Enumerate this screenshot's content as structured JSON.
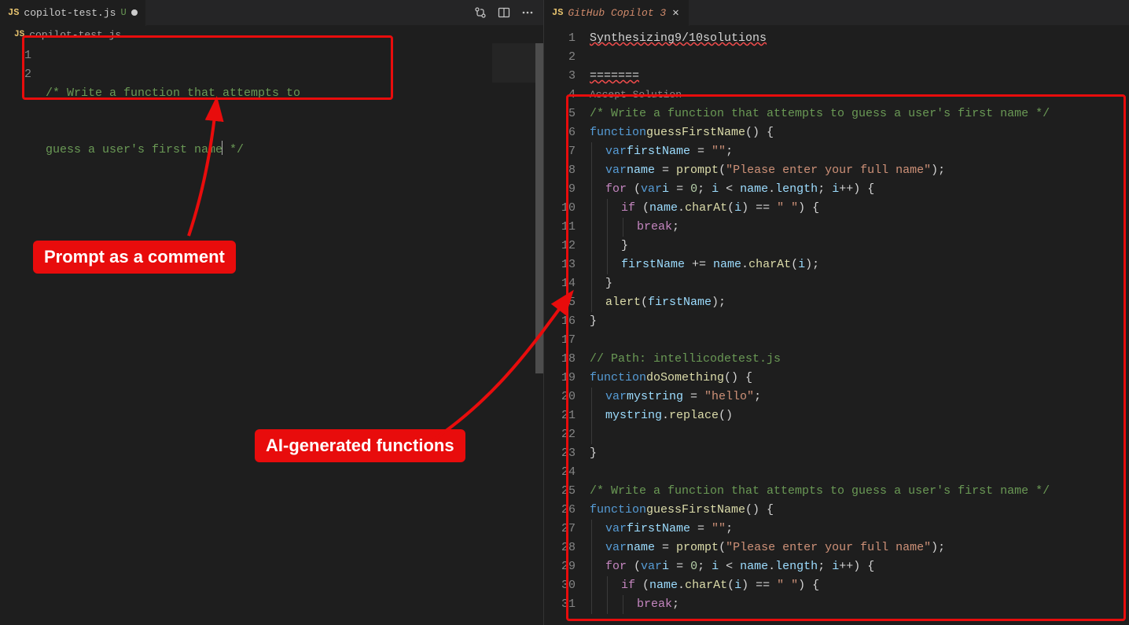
{
  "left": {
    "tab": {
      "icon": "JS",
      "title": "copilot-test.js",
      "badge": "U"
    },
    "breadcrumb": {
      "icon": "JS",
      "text": "copilot-test.js"
    },
    "lines": [
      "1",
      "2"
    ],
    "code": {
      "l1": "/* Write a function that attempts to",
      "l2a": "guess a user's first name",
      "l2b": " */"
    }
  },
  "right": {
    "tab": {
      "icon": "JS",
      "title": "GitHub Copilot 3"
    },
    "lines": [
      "1",
      "2",
      "3",
      "4",
      "5",
      "6",
      "7",
      "8",
      "9",
      "10",
      "11",
      "12",
      "13",
      "14",
      "15",
      "16",
      "17",
      "18",
      "19",
      "20",
      "21",
      "22",
      "23",
      "24",
      "25",
      "26",
      "27",
      "28",
      "29",
      "30",
      "31"
    ],
    "accept_label": "Accept Solution",
    "code": {
      "synth_a": "Synthesizing",
      "synth_b": "9/10",
      "synth_c": "solutions",
      "sep": "=======",
      "c5": "/* Write a function that attempts to guess a user's first name */",
      "fn1_kw": "function",
      "fn1_name": "guessFirstName",
      "fn1_open": "() {",
      "var_kw": "var",
      "first_name": "firstName",
      "eq_empty": " = ",
      "empty_str": "\"\"",
      "semi": ";",
      "name_id": "name",
      "eq": " = ",
      "prompt_fn": "prompt",
      "prompt_open": "(",
      "prompt_str": "\"Please enter your full name\"",
      "prompt_close": ");",
      "for_kw": "for",
      "for_open": " (",
      "i_id": "i",
      "zero": "0",
      "lt": " < ",
      "len_id": "length",
      "inc": "++) {",
      "if_kw": "if",
      "charAt": "charAt",
      "space_str": "\" \"",
      "eqeq": " == ",
      "break_kw": "break",
      "plus_eq": " += ",
      "alert_fn": "alert",
      "close_brace": "}",
      "path_comment": "// Path: intellicodetest.js",
      "fn2_name": "doSomething",
      "mystring": "mystring",
      "hello": "\"hello\"",
      "replace_fn": "replace",
      "empty_paren": "()"
    }
  },
  "annotations": {
    "prompt_label": "Prompt as a comment",
    "functions_label": "AI-generated functions"
  }
}
